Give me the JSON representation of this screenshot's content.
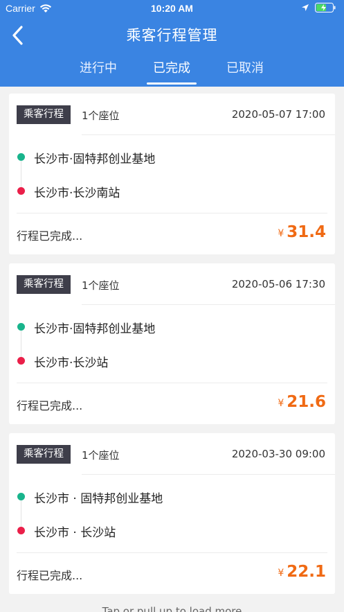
{
  "status_bar": {
    "carrier": "Carrier",
    "time": "10:20 AM"
  },
  "nav": {
    "title": "乘客行程管理"
  },
  "tabs": [
    {
      "label": "进行中"
    },
    {
      "label": "已完成"
    },
    {
      "label": "已取消"
    }
  ],
  "active_tab": "已完成",
  "trips": [
    {
      "badge": "乘客行程",
      "seats": "1个座位",
      "datetime": "2020-05-07 17:00",
      "from": "长沙市·固特邦创业基地",
      "to": "长沙市·长沙南站",
      "status": "行程已完成...",
      "currency": "¥",
      "amount": "31.4"
    },
    {
      "badge": "乘客行程",
      "seats": "1个座位",
      "datetime": "2020-05-06 17:30",
      "from": "长沙市·固特邦创业基地",
      "to": "长沙市·长沙站",
      "status": "行程已完成...",
      "currency": "¥",
      "amount": "21.6"
    },
    {
      "badge": "乘客行程",
      "seats": "1个座位",
      "datetime": "2020-03-30 09:00",
      "from": "长沙市 · 固特邦创业基地",
      "to": "长沙市 · 长沙站",
      "status": "行程已完成...",
      "currency": "¥",
      "amount": "22.1"
    }
  ],
  "footer": {
    "load_more": "Tap or pull up to load more"
  },
  "colors": {
    "primary": "#3a84e2",
    "price": "#f06a14",
    "from_dot": "#19b48c",
    "to_dot": "#ea1f49",
    "badge_bg": "#3e3e4a"
  },
  "icons": {
    "back": "chevron-left-icon",
    "wifi": "wifi-icon",
    "location": "location-arrow-icon",
    "battery": "battery-charging-icon"
  }
}
